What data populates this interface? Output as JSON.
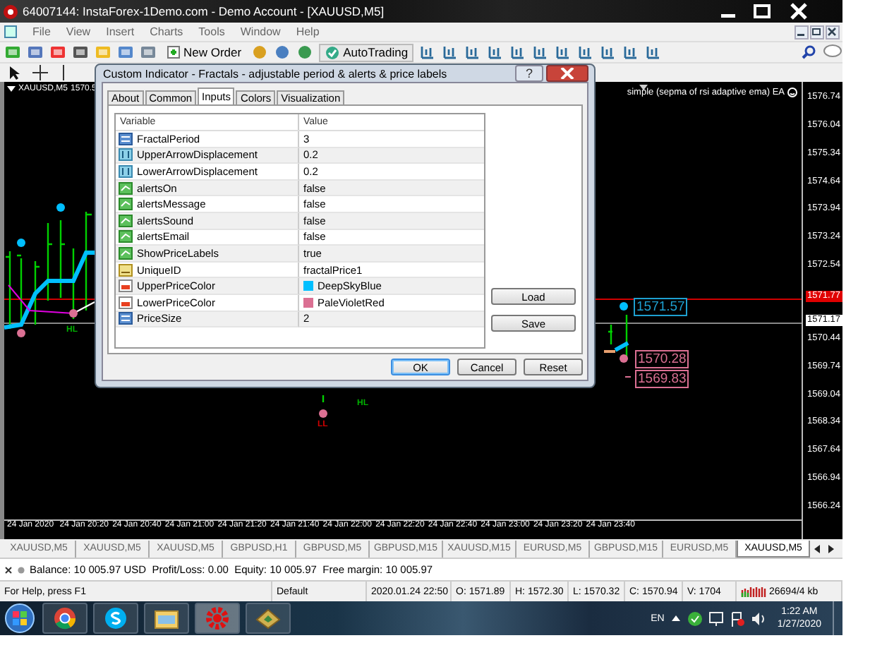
{
  "window": {
    "title": "64007144: InstaForex-1Demo.com - Demo Account - [XAUUSD,M5]"
  },
  "menu": [
    "File",
    "View",
    "Insert",
    "Charts",
    "Tools",
    "Window",
    "Help"
  ],
  "toolbar": {
    "new_order": "New Order",
    "auto_trading": "AutoTrading"
  },
  "chart": {
    "symbol": "XAUUSD,M5",
    "price": "1570.5",
    "indicator": "simple (sepma of rsi adaptive ema) EA",
    "price_axis": [
      {
        "label": "1576.74",
        "kind": "tick"
      },
      {
        "label": "1576.04",
        "kind": "tick"
      },
      {
        "label": "1575.34",
        "kind": "tick"
      },
      {
        "label": "1574.64",
        "kind": "tick"
      },
      {
        "label": "1573.94",
        "kind": "tick"
      },
      {
        "label": "1573.24",
        "kind": "tick"
      },
      {
        "label": "1572.54",
        "kind": "tick"
      },
      {
        "label": "1571.77",
        "kind": "bid"
      },
      {
        "label": "1571.17",
        "kind": "ask"
      },
      {
        "label": "1570.44",
        "kind": "tick"
      },
      {
        "label": "1569.74",
        "kind": "tick"
      },
      {
        "label": "1569.04",
        "kind": "tick"
      },
      {
        "label": "1568.34",
        "kind": "tick"
      },
      {
        "label": "1567.64",
        "kind": "tick"
      },
      {
        "label": "1566.94",
        "kind": "tick"
      },
      {
        "label": "1566.24",
        "kind": "tick"
      }
    ],
    "time_axis": [
      "24 Jan 2020",
      "24 Jan 20:20",
      "24 Jan 20:40",
      "24 Jan 21:00",
      "24 Jan 21:20",
      "24 Jan 21:40",
      "24 Jan 22:00",
      "24 Jan 22:20",
      "24 Jan 22:40",
      "24 Jan 23:00",
      "24 Jan 23:20",
      "24 Jan 23:40"
    ],
    "price_labels": [
      {
        "text": "1571.57",
        "color": "#1ea0d0"
      },
      {
        "text": "1570.28",
        "color": "#db7093"
      },
      {
        "text": "1569.83",
        "color": "#db7093"
      }
    ],
    "markers": [
      {
        "text": "HL",
        "color": "#00b000"
      },
      {
        "text": "HL",
        "color": "#00b000"
      },
      {
        "text": "LL",
        "color": "#d00000"
      }
    ]
  },
  "dialog": {
    "title": "Custom Indicator - Fractals - adjustable period & alerts & price labels",
    "help": "?",
    "tabs": [
      {
        "label": "About",
        "selected": false
      },
      {
        "label": "Common",
        "selected": false
      },
      {
        "label": "Inputs",
        "selected": true
      },
      {
        "label": "Colors",
        "selected": false
      },
      {
        "label": "Visualization",
        "selected": false
      }
    ],
    "columns": [
      "Variable",
      "Value"
    ],
    "rows": [
      {
        "kind": "int",
        "name": "FractalPeriod",
        "value": "3"
      },
      {
        "kind": "double",
        "name": "UpperArrowDisplacement",
        "value": "0.2"
      },
      {
        "kind": "double",
        "name": "LowerArrowDisplacement",
        "value": "0.2"
      },
      {
        "kind": "bool",
        "name": "alertsOn",
        "value": "false"
      },
      {
        "kind": "bool",
        "name": "alertsMessage",
        "value": "false"
      },
      {
        "kind": "bool",
        "name": "alertsSound",
        "value": "false"
      },
      {
        "kind": "bool",
        "name": "alertsEmail",
        "value": "false"
      },
      {
        "kind": "bool",
        "name": "ShowPriceLabels",
        "value": "true"
      },
      {
        "kind": "string",
        "name": "UniqueID",
        "value": "fractalPrice1"
      },
      {
        "kind": "color",
        "name": "UpperPriceColor",
        "value": "DeepSkyBlue",
        "color": "#00bfff"
      },
      {
        "kind": "color",
        "name": "LowerPriceColor",
        "value": "PaleVioletRed",
        "color": "#db7093"
      },
      {
        "kind": "int",
        "name": "PriceSize",
        "value": "2"
      }
    ],
    "side_buttons": [
      "Load",
      "Save"
    ],
    "buttons": [
      {
        "label": "OK",
        "default": true
      },
      {
        "label": "Cancel",
        "default": false
      },
      {
        "label": "Reset",
        "default": false
      }
    ]
  },
  "symbol_tabs": [
    {
      "label": "XAUUSD,M5",
      "selected": false
    },
    {
      "label": "XAUUSD,M5",
      "selected": false
    },
    {
      "label": "XAUUSD,M5",
      "selected": false
    },
    {
      "label": "GBPUSD,H1",
      "selected": false
    },
    {
      "label": "GBPUSD,M5",
      "selected": false
    },
    {
      "label": "GBPUSD,M15",
      "selected": false
    },
    {
      "label": "XAUUSD,M15",
      "selected": false
    },
    {
      "label": "EURUSD,M5",
      "selected": false
    },
    {
      "label": "GBPUSD,M15",
      "selected": false
    },
    {
      "label": "EURUSD,M5",
      "selected": false
    },
    {
      "label": "XAUUSD,M5",
      "selected": true
    }
  ],
  "account_line": "Balance: 10 005.97 USD  Profit/Loss: 0.00  Equity: 10 005.97  Free margin: 10 005.97",
  "status_bar": [
    "For Help, press F1",
    "Default",
    "2020.01.24 22:50",
    "O: 1571.89",
    "H: 1572.30",
    "L: 1570.32",
    "C: 1570.94",
    "V: 1704",
    "26694/4 kb"
  ],
  "taskbar": {
    "language": "EN",
    "time": "1:22 AM",
    "date": "1/27/2020"
  }
}
